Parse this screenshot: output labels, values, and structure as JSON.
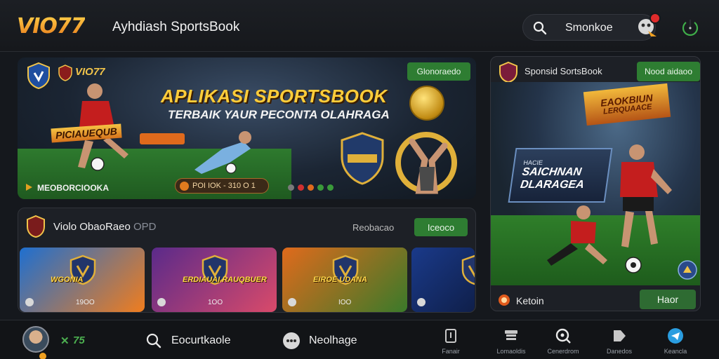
{
  "header": {
    "logo": "VIO77",
    "title": "Ayhdiash SportsBook",
    "search_label": "Smonkoe",
    "mascot_icon": "mascot-icon",
    "power_icon": "power-icon"
  },
  "hero": {
    "brand": "VIO77",
    "cta": "Glonoraedo",
    "headline": "APLIKASI SPORTSBOOK",
    "subheadline": "TERBAIK YAUR PECONTA OLAHRAGA",
    "player_sign": "PICIAUEQUB",
    "foot_label": "MEOBORCIOOKA",
    "promo": "POI IOK - 310 O 1",
    "dot_colors": [
      "#7a7a7a",
      "#d03030",
      "#e06a1c",
      "#3a9a3a",
      "#3a9a3a"
    ]
  },
  "feature": {
    "title": "Sponsid SortsBook",
    "cta": "Nood aidaoo",
    "banner_line1": "EAOKBIUN",
    "banner_line2": "LERQUAACE",
    "sign_small": "HACIE",
    "sign_big_1": "SAICHNAN",
    "sign_big_2": "DLARAGEA",
    "foot_label": "Ketoin",
    "foot_button": "Haor"
  },
  "games": {
    "title": "Violo ObaoRaeo",
    "title_suffix": "OPD",
    "link": "Reobacao",
    "button": "Iceoco",
    "tiles": [
      {
        "label": "WGONIA",
        "count": "19OO",
        "bg": "linear-gradient(135deg,#1e6fd0,#f07d1e)"
      },
      {
        "label": "ERDIAUAI RAUQBUER",
        "count": "1OO",
        "bg": "linear-gradient(135deg,#5a2a8a,#d94a6a)"
      },
      {
        "label": "EIROE UDANA",
        "count": "IOO",
        "bg": "linear-gradient(135deg,#e06a1c,#3a7a2a)"
      },
      {
        "label": "",
        "count": "",
        "bg": "linear-gradient(135deg,#1a3a8a,#0f1f4a)"
      }
    ]
  },
  "bottom_nav": {
    "score": "75",
    "search_label": "Eocurtkaole",
    "chat_label": "Neolhage",
    "items": [
      {
        "label": "Fanair",
        "icon": "document-icon"
      },
      {
        "label": "Lomaoldis",
        "icon": "receipt-icon"
      },
      {
        "label": "Cenerdrom",
        "icon": "search-circle-icon"
      },
      {
        "label": "Danedos",
        "icon": "tag-icon"
      },
      {
        "label": "Keancla",
        "icon": "telegram-icon"
      }
    ]
  }
}
